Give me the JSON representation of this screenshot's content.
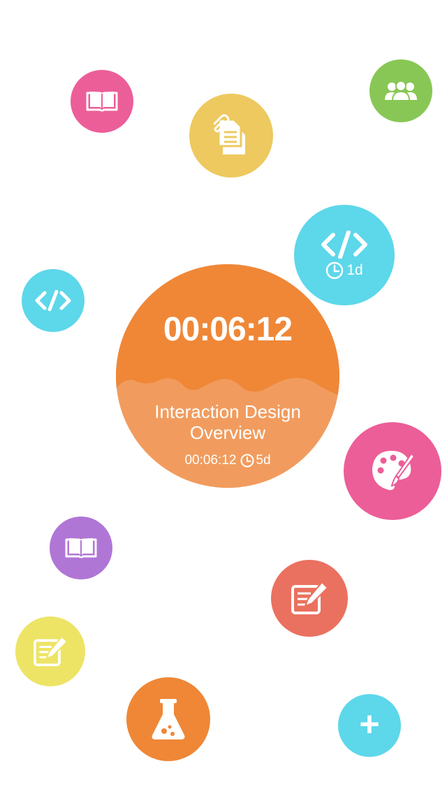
{
  "colors": {
    "pink": "#EC5E98",
    "yellow": "#EDC95F",
    "green": "#88C755",
    "cyan": "#5DD7EA",
    "orange": "#EF8737",
    "orange_light": "#F19C5E",
    "purple": "#B076D6",
    "coral": "#EA715F",
    "lime_yellow": "#EDE466"
  },
  "active_task": {
    "elapsed": "00:06:12",
    "title_line1": "Interaction Design",
    "title_line2": "Overview",
    "session_time": "00:06:12",
    "deadline": "5d"
  },
  "bubbles": [
    {
      "name": "reading-task",
      "icon": "book-icon",
      "color": "pink"
    },
    {
      "name": "documents-task",
      "icon": "documents-icon",
      "color": "yellow"
    },
    {
      "name": "team-task",
      "icon": "group-icon",
      "color": "green"
    },
    {
      "name": "coding-task-deadline",
      "icon": "code-icon",
      "color": "cyan",
      "deadline": "1d"
    },
    {
      "name": "coding-task",
      "icon": "code-icon",
      "color": "cyan"
    },
    {
      "name": "design-task",
      "icon": "palette-icon",
      "color": "pink"
    },
    {
      "name": "reading-task-2",
      "icon": "book-icon",
      "color": "purple"
    },
    {
      "name": "writing-task",
      "icon": "edit-icon",
      "color": "coral"
    },
    {
      "name": "writing-task-2",
      "icon": "edit-icon",
      "color": "lime_yellow"
    },
    {
      "name": "science-task",
      "icon": "flask-icon",
      "color": "orange"
    }
  ],
  "add_button": {
    "label": "+",
    "color": "cyan"
  }
}
